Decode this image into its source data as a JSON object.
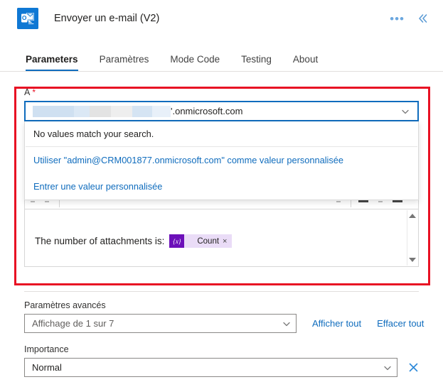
{
  "header": {
    "title": "Envoyer un e-mail (V2)",
    "app_icon": "outlook-send-email-icon",
    "more_label": "•••",
    "collapse_icon": "double-chevron-left-icon",
    "icon_color": "#0f78d4"
  },
  "tabs": [
    {
      "label": "Parameters",
      "active": true
    },
    {
      "label": "Paramètres",
      "active": false
    },
    {
      "label": "Mode Code",
      "active": false
    },
    {
      "label": "Testing",
      "active": false
    },
    {
      "label": "About",
      "active": false
    }
  ],
  "to_field": {
    "label": "À",
    "required_marker": "*",
    "redacted_prefix": "",
    "value_suffix": "'.onmicrosoft.com",
    "chevron_icon": "chevron-down-icon",
    "focus_color": "#0f6cbd"
  },
  "dropdown": {
    "no_match_message": "No values match your search.",
    "use_custom_value": "Utiliser \"admin@CRM001877.onmicrosoft.com\" comme valeur personnalisée",
    "enter_custom_value": "Entrer une valeur personnalisée",
    "link_color": "#0f6cbd"
  },
  "body_editor": {
    "text": "The number of attachments is:",
    "token": {
      "icon_glyph": "{x}",
      "icon_name": "expression-variable-icon",
      "label": "Count",
      "remove_glyph": "×",
      "icon_bg": "#6c10b9",
      "chip_bg": "#eadcf7"
    },
    "scroll_up_icon": "triangle-up-icon",
    "scroll_down_icon": "triangle-down-icon"
  },
  "advanced": {
    "label": "Paramètres avancés",
    "selected": "Affichage de 1 sur 7",
    "chevron_icon": "chevron-down-icon",
    "show_all": "Afficher tout",
    "clear_all": "Effacer tout"
  },
  "importance": {
    "label": "Importance",
    "selected": "Normal",
    "chevron_icon": "chevron-down-icon",
    "clear_icon": "close-x-icon",
    "clear_color": "#0f6cbd"
  },
  "highlight": {
    "color": "#e81123",
    "name": "red-annotation-box"
  }
}
